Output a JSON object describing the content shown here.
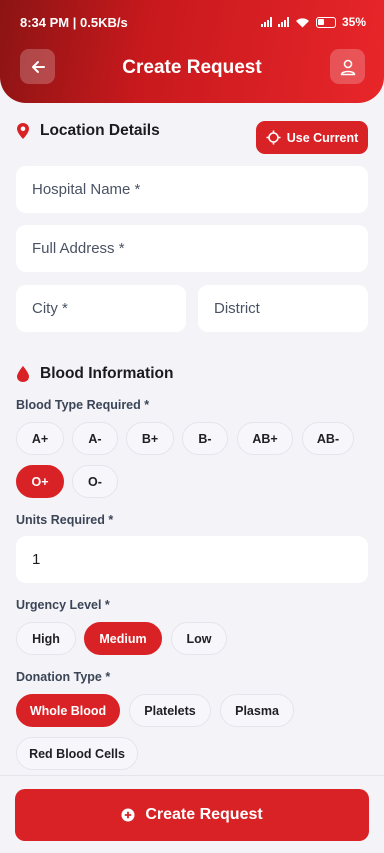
{
  "status_bar": {
    "time": "8:34 PM | 0.5KB/s",
    "battery": "35%"
  },
  "header": {
    "title": "Create Request"
  },
  "location": {
    "title": "Location Details",
    "use_current": "Use Current",
    "hospital_placeholder": "Hospital Name *",
    "address_placeholder": "Full Address *",
    "city_placeholder": "City *",
    "district_placeholder": "District"
  },
  "blood": {
    "title": "Blood Information",
    "type_label": "Blood Type Required *",
    "types": [
      "A+",
      "A-",
      "B+",
      "B-",
      "AB+",
      "AB-",
      "O+",
      "O-"
    ],
    "selected_type": "O+",
    "units_label": "Units Required *",
    "units_value": "1",
    "urgency_label": "Urgency Level *",
    "urgency": [
      "High",
      "Medium",
      "Low"
    ],
    "selected_urgency": "Medium",
    "donation_label": "Donation Type *",
    "donation": [
      "Whole Blood",
      "Platelets",
      "Plasma",
      "Red Blood Cells"
    ],
    "selected_donation": "Whole Blood"
  },
  "footer": {
    "create_label": "Create Request"
  },
  "colors": {
    "accent": "#d92226",
    "header_dark": "#8c1414",
    "background": "#f4f3f8"
  }
}
